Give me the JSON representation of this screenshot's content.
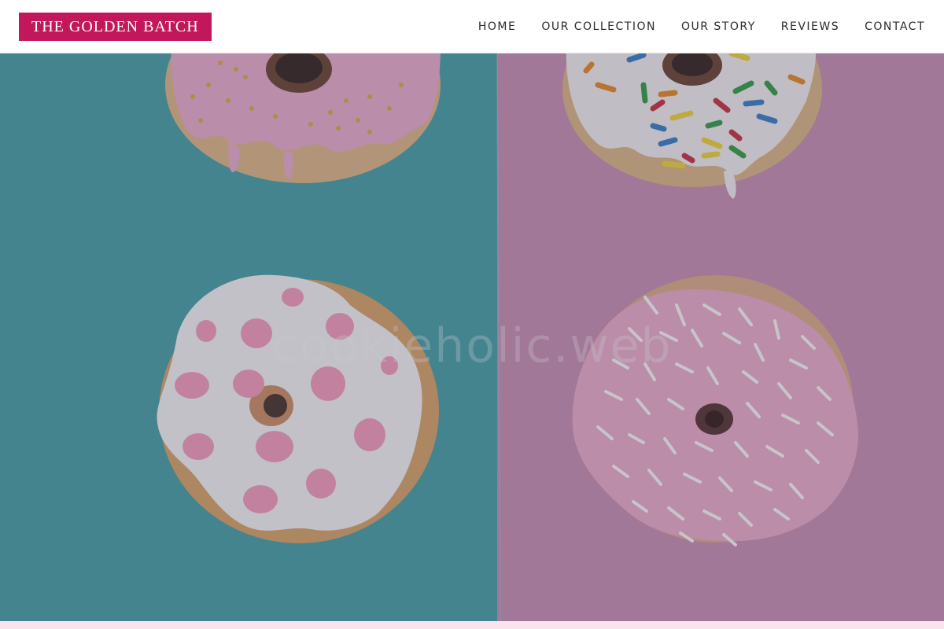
{
  "header": {
    "logo_text": "THE GOLDEN BATCH",
    "nav": [
      {
        "label": "HOME"
      },
      {
        "label": "OUR COLLECTION"
      },
      {
        "label": "OUR STORY"
      },
      {
        "label": "REVIEWS"
      },
      {
        "label": "CONTACT"
      }
    ]
  },
  "hero": {
    "watermark_text": "cookieholic.web"
  },
  "colors": {
    "brand": "#c2185b",
    "teal_background": "#4b9ea6",
    "pink_background": "#c48fb3",
    "overlay": "rgba(40,40,60,0.22)"
  }
}
